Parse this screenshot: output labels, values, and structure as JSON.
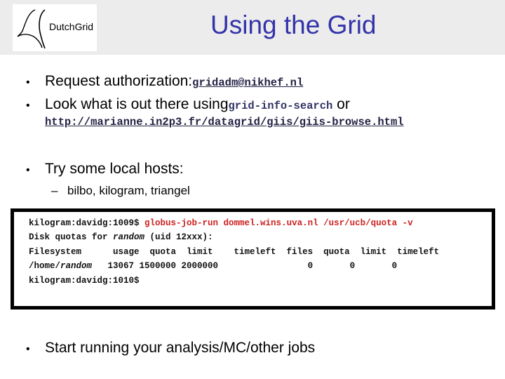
{
  "header": {
    "logo_text": "DutchGrid",
    "title": "Using the Grid",
    "title_color": "#3333aa",
    "background": "#ececec"
  },
  "bullets": [
    {
      "text": "Request authorization: ",
      "code": "gridadm@nikhef.nl"
    },
    {
      "text": "Look what is out there using ",
      "code": "grid-info-search",
      "suffix": " or",
      "url": "http://marianne.in2p3.fr/datagrid/giis/giis-browse.html"
    },
    {
      "text": "Try some local hosts:",
      "sub": "bilbo, kilogram, triangel"
    },
    {
      "text": "Start running your analysis/MC/other jobs"
    }
  ],
  "terminal": {
    "command_color": "#cc2222",
    "lines": [
      {
        "prompt": "kilogram:davidg:1009$ ",
        "command": "globus-job-run dommel.wins.uva.nl /usr/ucb/quota -v"
      },
      {
        "pre": "Disk quotas for ",
        "italic": "random",
        "post": " (uid 12xxx):"
      },
      {
        "pre": "Filesystem      usage  quota  limit    timeleft  files  quota  limit  timeleft"
      },
      {
        "pre": "/home/",
        "italic": "random",
        "post": "   13067 1500000 2000000                 0       0       0"
      },
      {
        "prompt": "kilogram:davidg:1010$"
      }
    ]
  }
}
